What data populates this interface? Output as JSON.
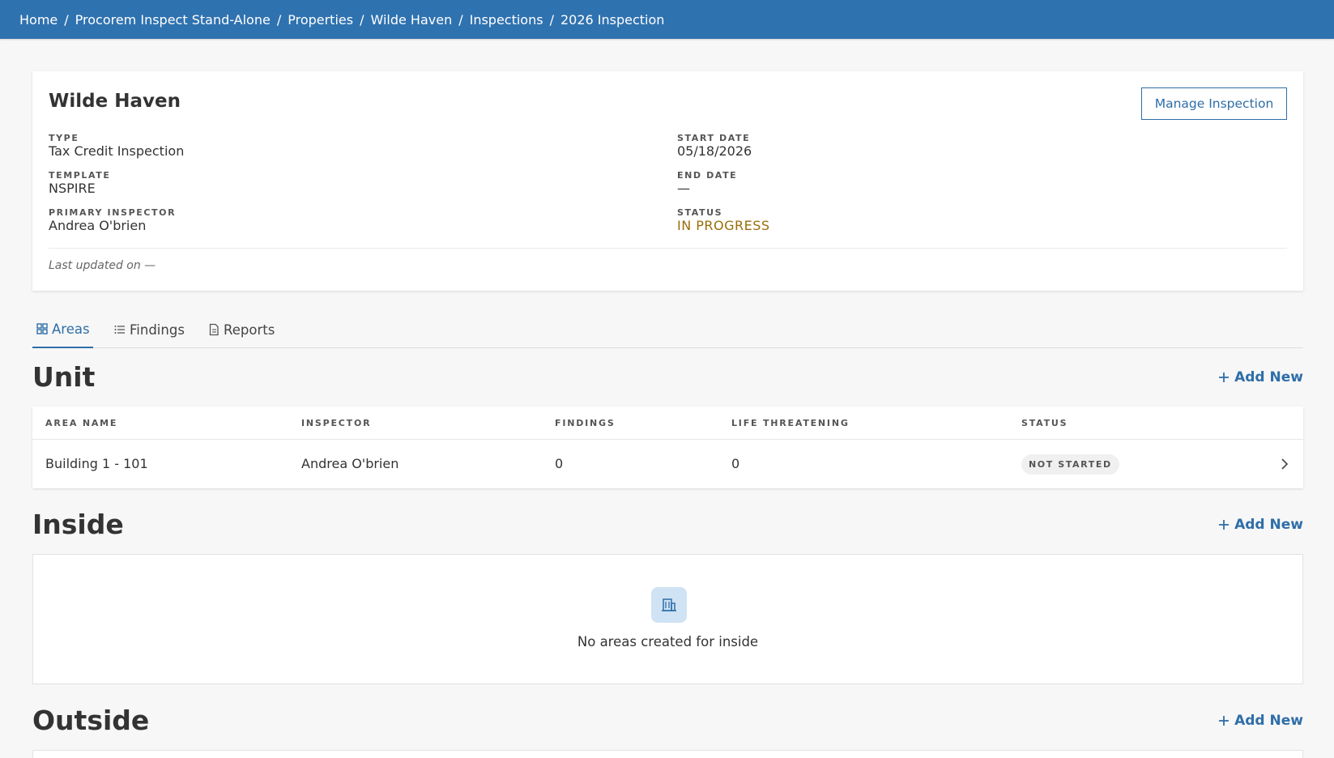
{
  "breadcrumb": [
    {
      "label": "Home"
    },
    {
      "label": "Procorem Inspect Stand-Alone"
    },
    {
      "label": "Properties"
    },
    {
      "label": "Wilde Haven"
    },
    {
      "label": "Inspections"
    },
    {
      "label": "2026 Inspection"
    }
  ],
  "breadcrumb_separator": "/",
  "header_card": {
    "title": "Wilde Haven",
    "manage_button": "Manage Inspection",
    "fields": {
      "type": {
        "label": "TYPE",
        "value": "Tax Credit Inspection"
      },
      "template": {
        "label": "TEMPLATE",
        "value": "NSPIRE"
      },
      "primary_inspector": {
        "label": "PRIMARY INSPECTOR",
        "value": "Andrea O'brien"
      },
      "start_date": {
        "label": "START DATE",
        "value": "05/18/2026"
      },
      "end_date": {
        "label": "END DATE",
        "value": "—"
      },
      "status": {
        "label": "STATUS",
        "value": "IN PROGRESS"
      }
    },
    "last_updated": "Last updated on —"
  },
  "tabs": [
    {
      "label": "Areas",
      "icon": "grid-icon",
      "active": true
    },
    {
      "label": "Findings",
      "icon": "list-icon",
      "active": false
    },
    {
      "label": "Reports",
      "icon": "document-icon",
      "active": false
    }
  ],
  "sections": {
    "unit": {
      "title": "Unit",
      "add_label": "Add New",
      "columns": [
        "AREA NAME",
        "INSPECTOR",
        "FINDINGS",
        "LIFE THREATENING",
        "STATUS"
      ],
      "rows": [
        {
          "area_name": "Building 1 - 101",
          "inspector": "Andrea O'brien",
          "findings": "0",
          "life_threatening": "0",
          "status": "NOT STARTED"
        }
      ]
    },
    "inside": {
      "title": "Inside",
      "add_label": "Add New",
      "empty_message": "No areas created for inside",
      "empty_icon": "building-icon"
    },
    "outside": {
      "title": "Outside",
      "add_label": "Add New"
    }
  },
  "colors": {
    "topbar": "#2f72b0",
    "accent": "#2f6ea8",
    "status_in_progress": "#9a6d08",
    "empty_icon_bg": "#cfe3f4"
  }
}
